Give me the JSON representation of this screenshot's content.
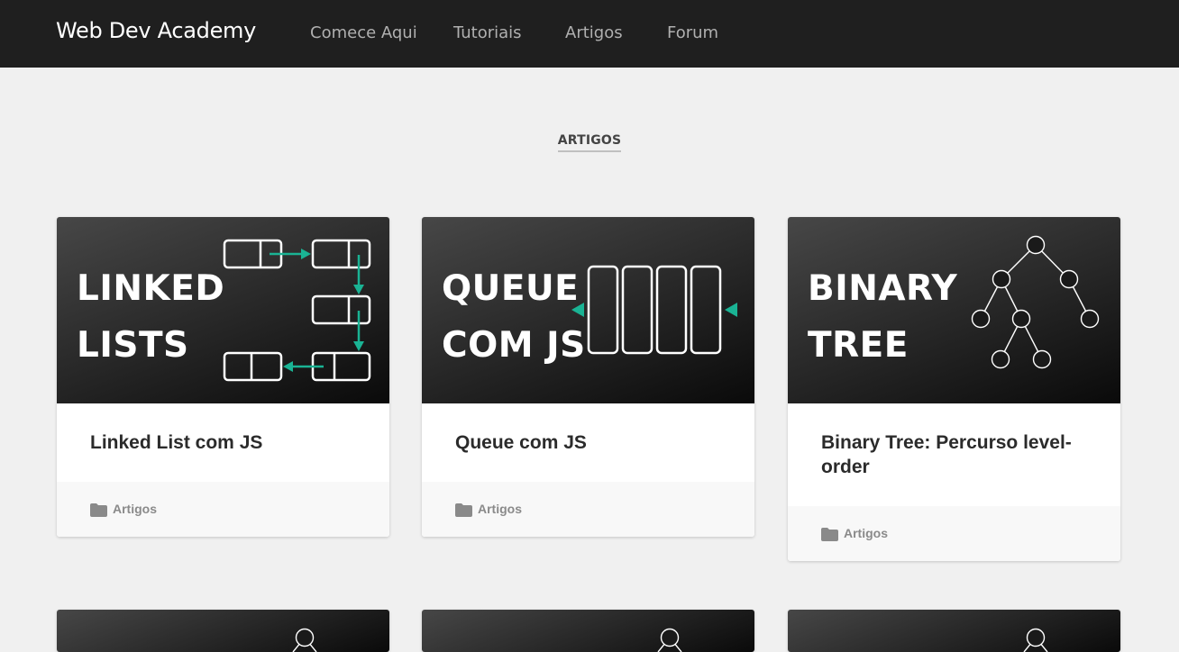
{
  "header": {
    "brand": "Web Dev Academy",
    "nav": [
      "Comece Aqui",
      "Tutoriais",
      "Artigos",
      "Forum"
    ]
  },
  "section": {
    "title": "ARTIGOS"
  },
  "cards": [
    {
      "thumb_lines": [
        "LINKED",
        "LISTS"
      ],
      "title": "Linked List com JS",
      "category": "Artigos"
    },
    {
      "thumb_lines": [
        "QUEUE",
        "COM JS"
      ],
      "title": "Queue com JS",
      "category": "Artigos"
    },
    {
      "thumb_lines": [
        "BINARY",
        "TREE"
      ],
      "title": "Binary Tree: Percurso level-order",
      "category": "Artigos"
    }
  ],
  "colors": {
    "accent": "#1ab394",
    "topbar": "#1f1f1f",
    "background": "#f0f0f0"
  },
  "icons": {
    "category": "folder-icon"
  }
}
